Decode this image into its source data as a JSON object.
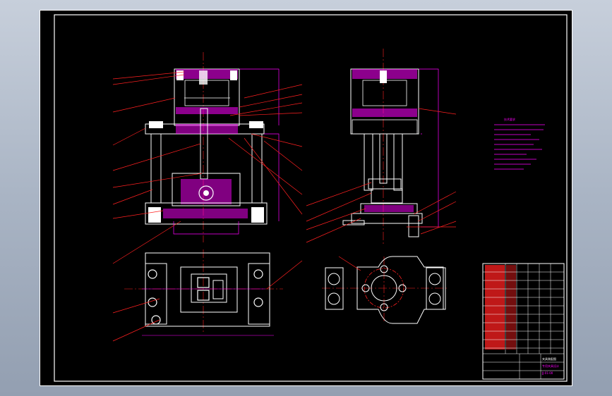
{
  "drawing": {
    "title_block_text": "夹具装配图",
    "subtitle": "专用夹具设计",
    "drawing_number": "JJ-01-00",
    "notes_title": "技术要求"
  },
  "colors": {
    "background": "#000000",
    "frame": "#ffffff",
    "section": "#ff00ff",
    "center": "#ff2020",
    "leader": "#ff2020",
    "body": "#d8d8d8"
  }
}
